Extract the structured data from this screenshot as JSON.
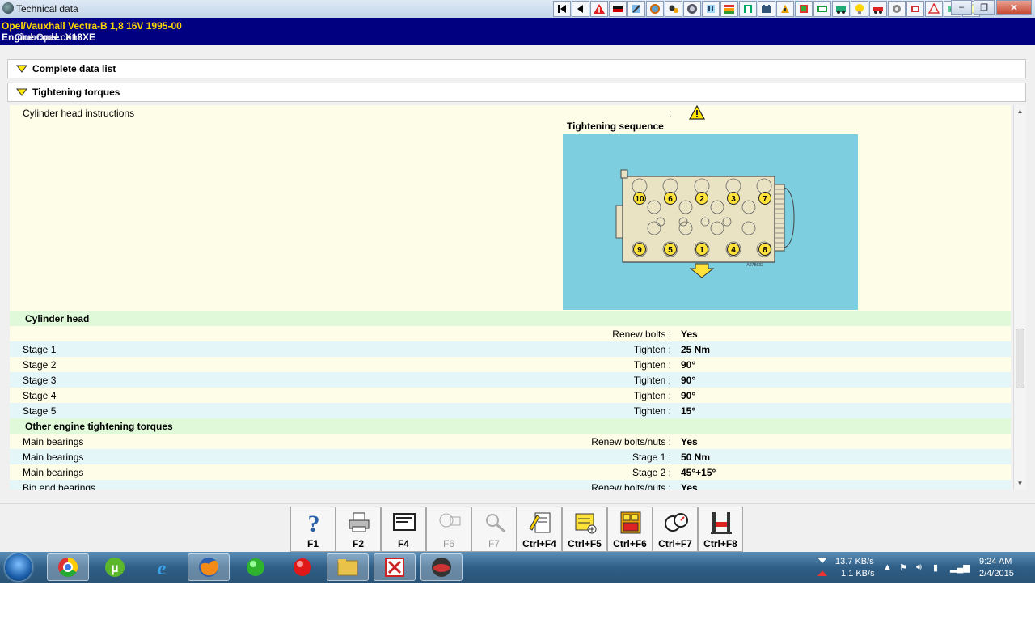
{
  "window": {
    "title": "Technical data",
    "controls": {
      "minimize": "–",
      "restore": "❐",
      "close": "✕"
    }
  },
  "header": {
    "line1": "Opel/Vauxhall   Vectra-B  1,8 16V 1995-00",
    "line2": "Engine code: X18XE",
    "watermark": "ClubOpel.com"
  },
  "toolbar": {
    "icons": [
      "first-icon",
      "previous-icon",
      "warning-icon",
      "flag-icon",
      "tool-icon",
      "gear-icon",
      "settings-icon",
      "wheel-icon",
      "cooling-icon",
      "adjust-icon",
      "timing-icon",
      "battery-icon",
      "ecu-icon",
      "manual-icon",
      "repair-icon",
      "lamp-icon",
      "bulb-icon",
      "car-icon",
      "transmission-icon",
      "tyre-icon",
      "caution-icon",
      "camera-icon",
      "notes-icon"
    ]
  },
  "sections": {
    "complete_data": "Complete data list",
    "tightening": "Tightening torques"
  },
  "instructions": {
    "label": "Cylinder head instructions",
    "colon": ":",
    "sequence_title": "Tightening sequence",
    "diagram_code": "A07B032",
    "bolt_order_top": [
      "10",
      "6",
      "2",
      "3",
      "7"
    ],
    "bolt_order_bottom": [
      "9",
      "5",
      "1",
      "4",
      "8"
    ]
  },
  "groups": {
    "cylinder_head": "Cylinder head",
    "other": "Other engine tightening torques"
  },
  "rows": [
    {
      "name": "",
      "param": "Renew bolts :",
      "value": "Yes"
    },
    {
      "name": "Stage 1",
      "param": "Tighten :",
      "value": "25 Nm"
    },
    {
      "name": "Stage 2",
      "param": "Tighten :",
      "value": "90°"
    },
    {
      "name": "Stage 3",
      "param": "Tighten :",
      "value": "90°"
    },
    {
      "name": "Stage 4",
      "param": "Tighten :",
      "value": "90°"
    },
    {
      "name": "Stage 5",
      "param": "Tighten :",
      "value": "15°"
    },
    {
      "name": "Main bearings",
      "param": "Renew bolts/nuts :",
      "value": "Yes"
    },
    {
      "name": "Main bearings",
      "param": "Stage 1 :",
      "value": "50 Nm"
    },
    {
      "name": "Main bearings",
      "param": "Stage 2 :",
      "value": "45°+15°"
    },
    {
      "name": "Big end bearings",
      "param": "Renew bolts/nuts :",
      "value": "Yes"
    }
  ],
  "function_keys": [
    {
      "label": "F1",
      "icon": "help-icon",
      "enabled": true
    },
    {
      "label": "F2",
      "icon": "print-icon",
      "enabled": true
    },
    {
      "label": "F4",
      "icon": "screen-icon",
      "enabled": true
    },
    {
      "label": "F6",
      "icon": "text-icon",
      "enabled": false
    },
    {
      "label": "F7",
      "icon": "zoom-icon",
      "enabled": false
    },
    {
      "label": "Ctrl+F4",
      "icon": "edit-note-icon",
      "enabled": true
    },
    {
      "label": "Ctrl+F5",
      "icon": "add-note-icon",
      "enabled": true
    },
    {
      "label": "Ctrl+F6",
      "icon": "calculator-icon",
      "enabled": true
    },
    {
      "label": "Ctrl+F7",
      "icon": "gauge-icon",
      "enabled": true
    },
    {
      "label": "Ctrl+F8",
      "icon": "lift-icon",
      "enabled": true
    }
  ],
  "taskbar": {
    "apps": [
      "chrome-icon",
      "utorrent-icon",
      "internet-explorer-icon",
      "firefox-icon",
      "green-ball-icon",
      "red-ball-icon",
      "folder-icon",
      "app-icon",
      "autodata-icon"
    ],
    "net_down": "13.7 KB/s",
    "net_up": "1.1 KB/s",
    "time": "9:24 AM",
    "date": "2/4/2015"
  },
  "colors": {
    "header_bg": "#000080",
    "header_text1": "#ffd700",
    "row_yellow": "#fefde7",
    "row_blue": "#e4f6f8",
    "row_green": "#dff9d9",
    "diagram_bg": "#7dcedf"
  }
}
